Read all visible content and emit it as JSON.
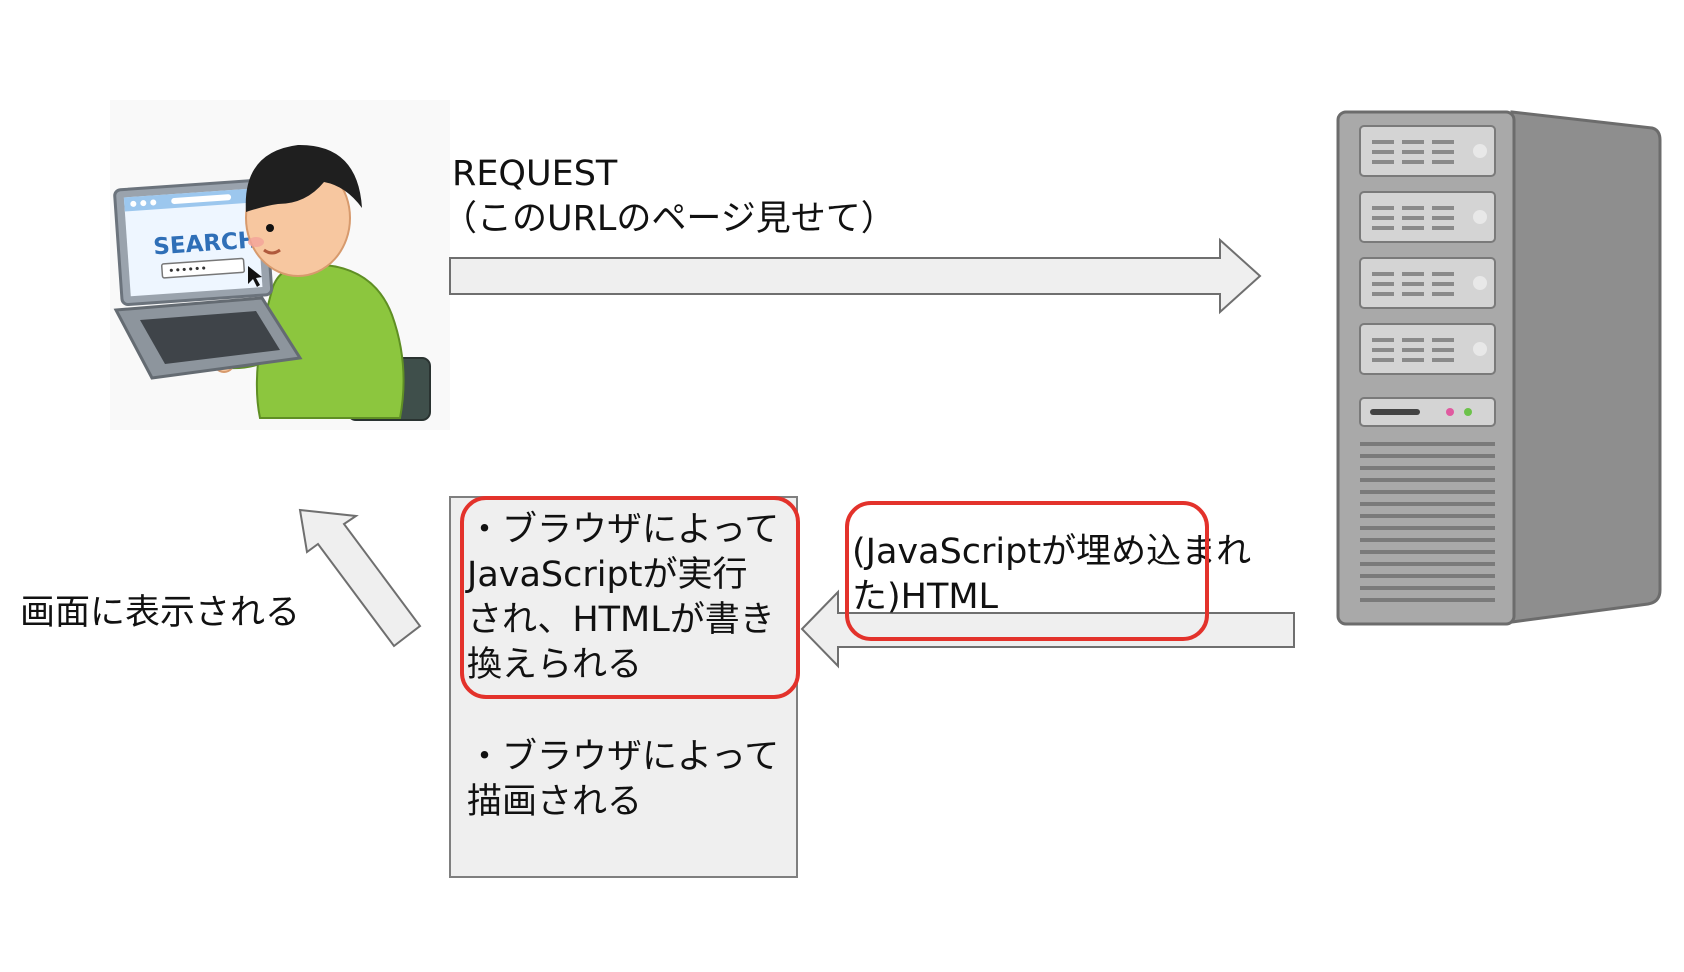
{
  "request": {
    "line1": "REQUEST",
    "line2": "（このURLのページ見せて）"
  },
  "response": {
    "label": "(JavaScriptが埋め込まれた)HTML"
  },
  "browser_steps": {
    "step1": "・ブラウザによって\nJavaScriptが実行\nされ、HTMLが書き\n換えられる",
    "step2": "・ブラウザによって\n描画される"
  },
  "display": {
    "label": "画面に表示される"
  },
  "laptop": {
    "screen_word": "SEARCH",
    "search_value": "••••••"
  },
  "colors": {
    "arrow_fill": "#efefef",
    "arrow_stroke": "#6f6f6f",
    "highlight": "#e3322b",
    "shirt": "#8cc63e",
    "server": "#9a9a9a"
  }
}
